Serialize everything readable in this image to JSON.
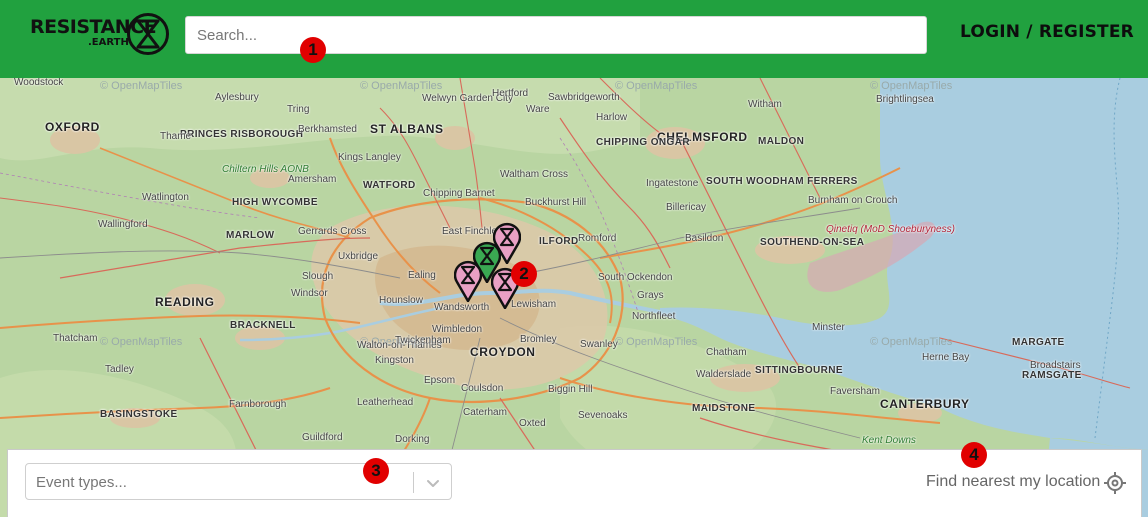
{
  "header": {
    "logo_text": "RESISTANCE",
    "logo_subtext": ".EARTH",
    "search_placeholder": "Search...",
    "login_label": "LOGIN / REGISTER"
  },
  "map": {
    "attribution": "© OpenMapTiles",
    "places_major": [
      "OXFORD",
      "ST ALBANS",
      "CHELMSFORD",
      "READING",
      "CROYDON",
      "CANTERBURY",
      "MAIDSTONE",
      "CHIPPING ONGAR",
      "SOUTH WOODHAM FERRERS",
      "SOUTHEND-ON-SEA",
      "SITTINGBOURNE",
      "MARGATE",
      "RAMSGATE",
      "PRINCES RISBOROUGH",
      "HIGH WYCOMBE",
      "MARLOW",
      "BRACKNELL",
      "BASINGSTOKE",
      "WATFORD",
      "ILFORD",
      "MALDON"
    ],
    "places_minor": [
      "Woodstock",
      "Aylesbury",
      "Tring",
      "Welwyn Garden City",
      "Hertford",
      "Ware",
      "Sawbridgeworth",
      "Harlow",
      "Witham",
      "Brightlingsea",
      "Thame",
      "Berkhamsted",
      "Kings Langley",
      "Chiltern Hills AONB",
      "Amersham",
      "Chipping Barnet",
      "Waltham Cross",
      "Buckhurst Hill",
      "Ingatestone",
      "Billericay",
      "Burnham on Crouch",
      "Qinetiq (MoD Shoeburyness)",
      "Watlington",
      "Wallingford",
      "Gerrards Cross",
      "Uxbridge",
      "East Finchley",
      "Romford",
      "Basildon",
      "Slough",
      "Windsor",
      "Ealing",
      "Hounslow",
      "Wandsworth",
      "Wimbledon",
      "South Ockendon",
      "Grays",
      "Northfleet",
      "Lewisham",
      "Thatcham",
      "Walton-on-Thames",
      "Epsom",
      "Coulsdon",
      "Bromley",
      "Swanley",
      "Chatham",
      "Walderslade",
      "Minster",
      "Herne Bay",
      "Broadstairs",
      "Tadley",
      "Farnborough",
      "Leatherhead",
      "Guildford",
      "Dorking",
      "Caterham",
      "Oxted",
      "Sevenoaks",
      "Biggin Hill",
      "Faversham",
      "Kent Downs",
      "Twickenham",
      "Kingston"
    ],
    "markers": [
      {
        "label": "event-marker-pink-north",
        "color": "#e9a0c4"
      },
      {
        "label": "event-marker-green",
        "color": "#3aa852"
      },
      {
        "label": "event-marker-pink-west",
        "color": "#e9a0c4"
      },
      {
        "label": "event-marker-pink-south",
        "color": "#e9a0c4"
      }
    ]
  },
  "annotations": [
    "1",
    "2",
    "3",
    "4"
  ],
  "filters": {
    "event_types_placeholder": "Event types...",
    "find_nearest_label": "Find nearest my location"
  },
  "colors": {
    "header_green": "#21a13f",
    "badge_red": "#e10000",
    "sea": "#a9cde0",
    "land": "#b9d5a2"
  }
}
